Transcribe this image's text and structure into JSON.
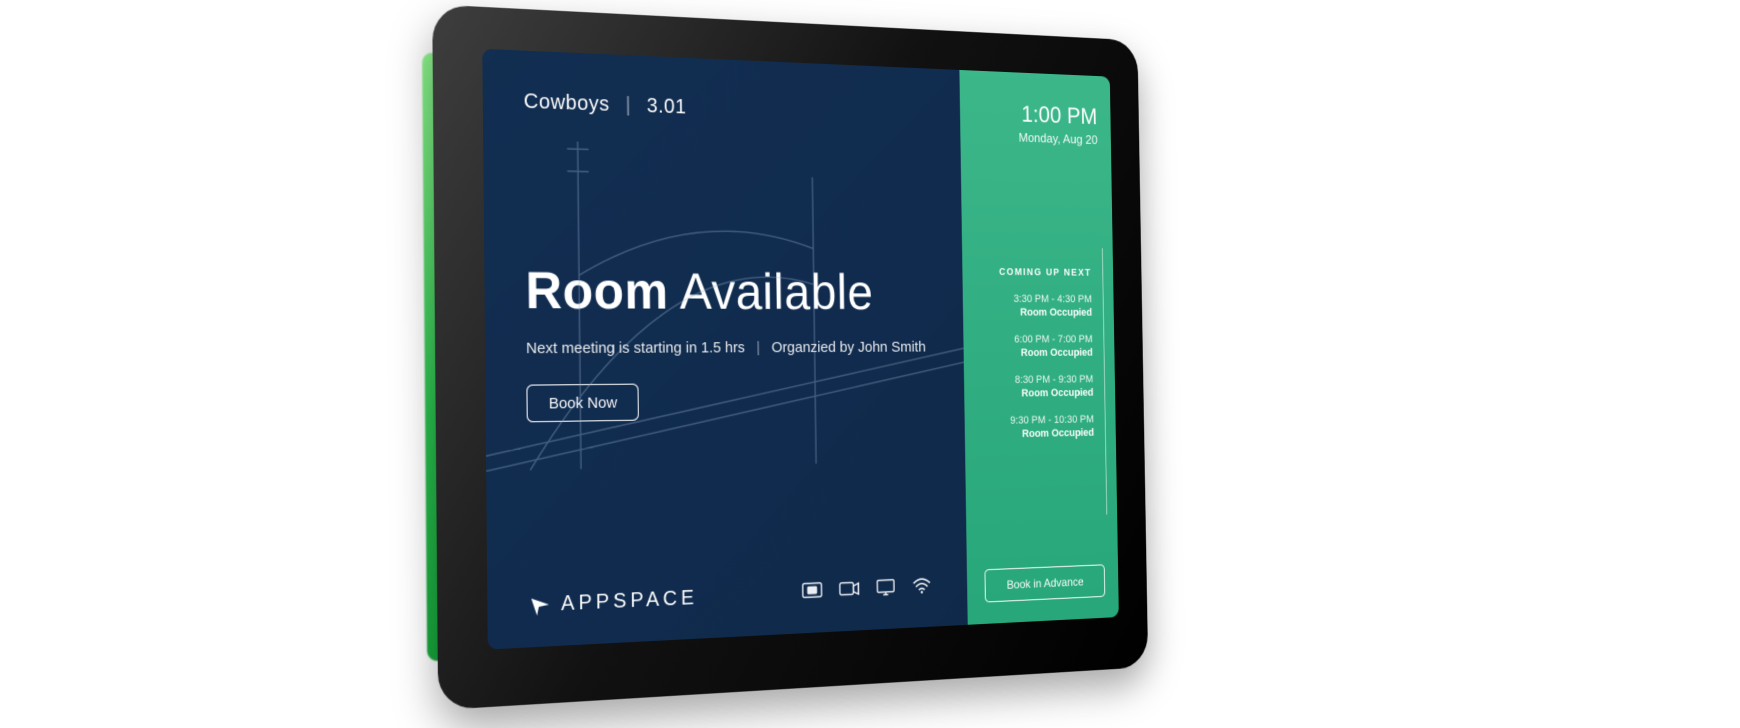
{
  "room": {
    "name": "Cowboys",
    "number": "3.01"
  },
  "status": {
    "title_bold": "Room",
    "title_rest": "Available",
    "next_meeting_text": "Next meeting is starting in 1.5 hrs",
    "organizer_text": "Organzied by John Smith"
  },
  "actions": {
    "book_now": "Book Now",
    "book_advance": "Book in Advance"
  },
  "clock": {
    "time": "1:00 PM",
    "date": "Monday, Aug 20"
  },
  "upnext_header": "COMING UP NEXT",
  "schedule": [
    {
      "time": "3:30 PM - 4:30 PM",
      "status": "Room Occupied"
    },
    {
      "time": "6:00 PM - 7:00 PM",
      "status": "Room Occupied"
    },
    {
      "time": "8:30 PM - 9:30 PM",
      "status": "Room Occupied"
    },
    {
      "time": "9:30 PM - 10:30 PM",
      "status": "Room Occupied"
    }
  ],
  "brand": {
    "name": "APPSPACE"
  },
  "equipment_icons": [
    "cast-icon",
    "video-camera-icon",
    "monitor-icon",
    "wifi-icon"
  ],
  "colors": {
    "panel_left": "#0f2a4a",
    "panel_right": "#2fae80",
    "led": "#37c557"
  }
}
